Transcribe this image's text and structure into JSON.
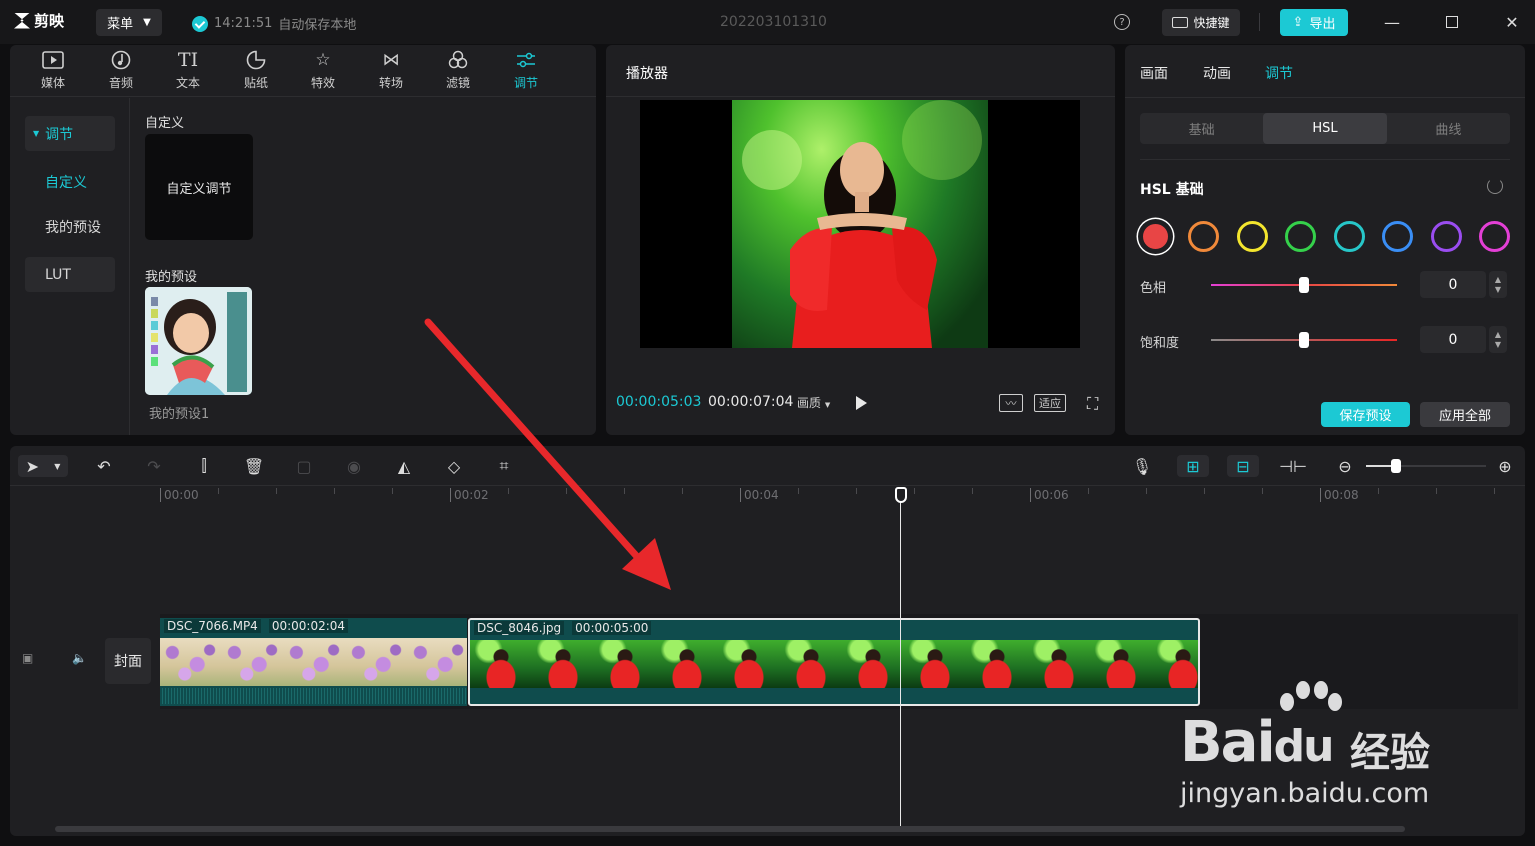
{
  "titlebar": {
    "app_name": "剪映",
    "menu_label": "菜单",
    "save_time": "14:21:51",
    "save_text": "自动保存本地",
    "project_name": "202203101310",
    "shortcut_label": "快捷键",
    "export_label": "导出"
  },
  "media_tabs": [
    {
      "label": "媒体",
      "icon": "media-icon"
    },
    {
      "label": "音频",
      "icon": "audio-icon"
    },
    {
      "label": "文本",
      "icon": "text-icon"
    },
    {
      "label": "贴纸",
      "icon": "sticker-icon"
    },
    {
      "label": "特效",
      "icon": "effects-icon"
    },
    {
      "label": "转场",
      "icon": "transition-icon"
    },
    {
      "label": "滤镜",
      "icon": "filter-icon"
    },
    {
      "label": "调节",
      "icon": "adjust-icon",
      "active": true
    }
  ],
  "left_nav": {
    "adjust": "调节",
    "custom": "自定义",
    "my_presets": "我的预设",
    "lut": "LUT"
  },
  "left_content": {
    "custom_section": "自定义",
    "custom_card": "自定义调节",
    "preset_section": "我的预设",
    "preset_name": "我的预设1"
  },
  "player": {
    "title": "播放器",
    "current_time": "00:00:05:03",
    "total_time": "00:00:07:04",
    "quality": "画质",
    "fit_label": "适应"
  },
  "right_panel": {
    "tabs": [
      "画面",
      "动画",
      "调节"
    ],
    "active_tab": "调节",
    "segments": [
      "基础",
      "HSL",
      "曲线"
    ],
    "active_segment": "HSL",
    "section_title": "HSL 基础",
    "swatches": [
      "#e84545",
      "#f0893a",
      "#f3e52e",
      "#35d14b",
      "#27c7c9",
      "#3a8ef5",
      "#9a4df0",
      "#e43fd6"
    ],
    "hue_label": "色相",
    "hue_value": "0",
    "saturation_label": "饱和度",
    "saturation_value": "0",
    "save_preset": "保存预设",
    "apply_all": "应用全部"
  },
  "timeline": {
    "ruler_labels": [
      "00:00",
      "00:02",
      "00:04",
      "00:06",
      "00:08"
    ],
    "cover_label": "封面",
    "clip_a": {
      "name": "DSC_7066.MP4",
      "duration": "00:00:02:04"
    },
    "clip_b": {
      "name": "DSC_8046.jpg",
      "duration": "00:00:05:00"
    }
  },
  "watermark": {
    "brand": "Bai",
    "brand_suffix": "du",
    "cn": "经验",
    "url": "jingyan.baidu.com"
  },
  "colors": {
    "accent": "#1cc9d4",
    "panel_bg": "#1f1f22",
    "arrow": "#e8282b"
  }
}
